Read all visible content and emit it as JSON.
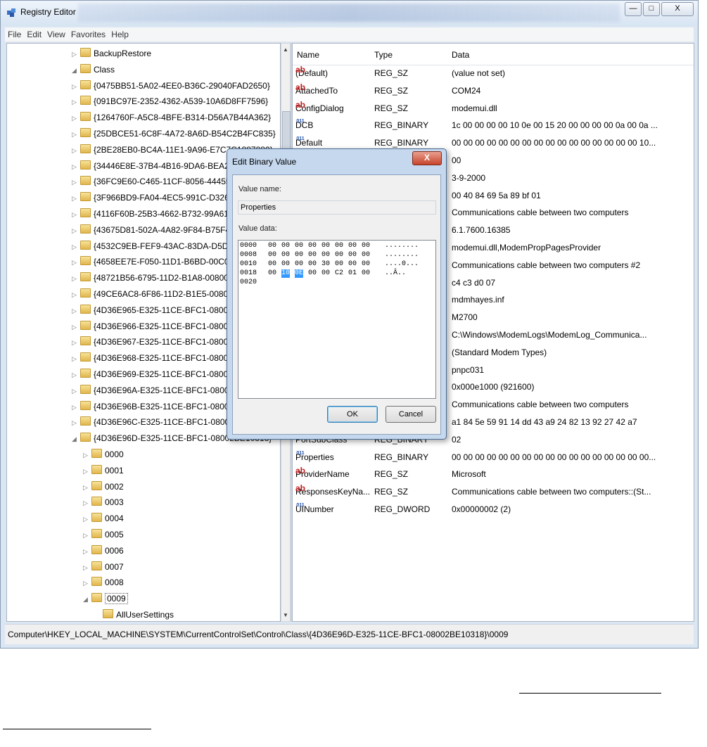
{
  "window": {
    "title": "Registry Editor",
    "controls": {
      "minimize": "—",
      "maximize": "□",
      "close": "X"
    }
  },
  "menu": [
    "File",
    "Edit",
    "View",
    "Favorites",
    "Help"
  ],
  "tree": [
    {
      "label": "BackupRestore",
      "level": 0,
      "expander": "▷"
    },
    {
      "label": "Class",
      "level": 0,
      "expander": "◢"
    },
    {
      "label": "{0475BB51-5A02-4EE0-B36C-29040FAD2650}",
      "level": 1,
      "expander": "▷"
    },
    {
      "label": "{091BC97E-2352-4362-A539-10A6D8FF7596}",
      "level": 1,
      "expander": "▷"
    },
    {
      "label": "{1264760F-A5C8-4BFE-B314-D56A7B44A362}",
      "level": 1,
      "expander": "▷"
    },
    {
      "label": "{25DBCE51-6C8F-4A72-8A6D-B54C2B4FC835}",
      "level": 1,
      "expander": "▷"
    },
    {
      "label": "{2BE28EB0-BC4A-11E1-9A96-E7C7C1887880}",
      "level": 1,
      "expander": "▷"
    },
    {
      "label": "{34446E8E-37B4-4B16-9DA6-BEA2",
      "level": 1,
      "expander": "▷"
    },
    {
      "label": "{36FC9E60-C465-11CF-8056-44455",
      "level": 1,
      "expander": "▷"
    },
    {
      "label": "{3F966BD9-FA04-4EC5-991C-D326",
      "level": 1,
      "expander": "▷"
    },
    {
      "label": "{4116F60B-25B3-4662-B732-99A61",
      "level": 1,
      "expander": "▷"
    },
    {
      "label": "{43675D81-502A-4A82-9F84-B75F4",
      "level": 1,
      "expander": "▷"
    },
    {
      "label": "{4532C9EB-FEF9-43AC-83DA-D5DE",
      "level": 1,
      "expander": "▷"
    },
    {
      "label": "{4658EE7E-F050-11D1-B6BD-00C0",
      "level": 1,
      "expander": "▷"
    },
    {
      "label": "{48721B56-6795-11D2-B1A8-00800",
      "level": 1,
      "expander": "▷"
    },
    {
      "label": "{49CE6AC8-6F86-11D2-B1E5-00800",
      "level": 1,
      "expander": "▷"
    },
    {
      "label": "{4D36E965-E325-11CE-BFC1-08002",
      "level": 1,
      "expander": "▷"
    },
    {
      "label": "{4D36E966-E325-11CE-BFC1-08002",
      "level": 1,
      "expander": "▷"
    },
    {
      "label": "{4D36E967-E325-11CE-BFC1-08002",
      "level": 1,
      "expander": "▷"
    },
    {
      "label": "{4D36E968-E325-11CE-BFC1-08002",
      "level": 1,
      "expander": "▷"
    },
    {
      "label": "{4D36E969-E325-11CE-BFC1-08002",
      "level": 1,
      "expander": "▷"
    },
    {
      "label": "{4D36E96A-E325-11CE-BFC1-08002",
      "level": 1,
      "expander": "▷"
    },
    {
      "label": "{4D36E96B-E325-11CE-BFC1-08002",
      "level": 1,
      "expander": "▷"
    },
    {
      "label": "{4D36E96C-E325-11CE-BFC1-08002",
      "level": 1,
      "expander": "▷"
    },
    {
      "label": "{4D36E96D-E325-11CE-BFC1-08002BE10318}",
      "level": 1,
      "expander": "◢"
    },
    {
      "label": "0000",
      "level": 2,
      "expander": "▷"
    },
    {
      "label": "0001",
      "level": 2,
      "expander": "▷"
    },
    {
      "label": "0002",
      "level": 2,
      "expander": "▷"
    },
    {
      "label": "0003",
      "level": 2,
      "expander": "▷"
    },
    {
      "label": "0004",
      "level": 2,
      "expander": "▷"
    },
    {
      "label": "0005",
      "level": 2,
      "expander": "▷"
    },
    {
      "label": "0006",
      "level": 2,
      "expander": "▷"
    },
    {
      "label": "0007",
      "level": 2,
      "expander": "▷"
    },
    {
      "label": "0008",
      "level": 2,
      "expander": "▷"
    },
    {
      "label": "0009",
      "level": 2,
      "expander": "◢"
    },
    {
      "label": "AllUserSettings",
      "level": 3,
      "expander": ""
    }
  ],
  "list": {
    "headers": {
      "name": "Name",
      "type": "Type",
      "data": "Data"
    },
    "rows": [
      {
        "icon": "ab",
        "name": "(Default)",
        "type": "REG_SZ",
        "data": "(value not set)"
      },
      {
        "icon": "ab",
        "name": "AttachedTo",
        "type": "REG_SZ",
        "data": "COM24"
      },
      {
        "icon": "ab",
        "name": "ConfigDialog",
        "type": "REG_SZ",
        "data": "modemui.dll"
      },
      {
        "icon": "bin",
        "name": "DCB",
        "type": "REG_BINARY",
        "data": "1c 00 00 00 00 10 0e 00 15 20 00 00 00 00 0a 00 0a ..."
      },
      {
        "icon": "bin",
        "name": "Default",
        "type": "REG_BINARY",
        "data": "00 00 00 00 00 00 00 00 00 00 00 00 00 00 00 00 10..."
      },
      {
        "icon": "bin",
        "name": "",
        "type": "",
        "data": "00"
      },
      {
        "icon": "",
        "name": "",
        "type": "",
        "data": "3-9-2000"
      },
      {
        "icon": "",
        "name": "",
        "type": "",
        "data": "00 40 84 69 5a 89 bf 01"
      },
      {
        "icon": "",
        "name": "",
        "type": "",
        "data": "Communications cable between two computers"
      },
      {
        "icon": "",
        "name": "",
        "type": "",
        "data": "6.1.7600.16385"
      },
      {
        "icon": "",
        "name": "",
        "type": "",
        "data": "modemui.dll,ModemPropPagesProvider"
      },
      {
        "icon": "",
        "name": "",
        "type": "",
        "data": "Communications cable between two computers #2"
      },
      {
        "icon": "",
        "name": "",
        "type": "",
        "data": "c4 c3 d0 07"
      },
      {
        "icon": "",
        "name": "",
        "type": "",
        "data": "mdmhayes.inf"
      },
      {
        "icon": "",
        "name": "",
        "type": "",
        "data": "M2700"
      },
      {
        "icon": "",
        "name": "",
        "type": "",
        "data": "C:\\Windows\\ModemLogs\\ModemLog_Communica..."
      },
      {
        "icon": "",
        "name": "",
        "type": "",
        "data": "(Standard Modem Types)"
      },
      {
        "icon": "",
        "name": "",
        "type": "",
        "data": "pnpc031"
      },
      {
        "icon": "",
        "name": "",
        "type": "",
        "data": "0x000e1000 (921600)"
      },
      {
        "icon": "",
        "name": "",
        "type": "",
        "data": "Communications cable between two computers"
      },
      {
        "icon": "",
        "name": "",
        "type": "",
        "data": "a1 84 5e 59 91 14 dd 43 a9 24 82 13 92 27 42 a7"
      },
      {
        "icon": "bin",
        "name": "PortSubClass",
        "type": "REG_BINARY",
        "data": "02"
      },
      {
        "icon": "bin",
        "name": "Properties",
        "type": "REG_BINARY",
        "data": "00 00 00 00 00 00 00 00 00 00 00 00 00 00 00 00 00..."
      },
      {
        "icon": "ab",
        "name": "ProviderName",
        "type": "REG_SZ",
        "data": "Microsoft"
      },
      {
        "icon": "ab",
        "name": "ResponsesKeyNa...",
        "type": "REG_SZ",
        "data": "Communications cable between two computers::(St..."
      },
      {
        "icon": "bin",
        "name": "UINumber",
        "type": "REG_DWORD",
        "data": "0x00000002 (2)"
      }
    ]
  },
  "statusbar": "Computer\\HKEY_LOCAL_MACHINE\\SYSTEM\\CurrentControlSet\\Control\\Class\\{4D36E96D-E325-11CE-BFC1-08002BE10318}\\0009",
  "dialog": {
    "title": "Edit Binary Value",
    "close": "X",
    "value_name_label": "Value name:",
    "value_name": "Properties",
    "value_data_label": "Value data:",
    "hex": [
      {
        "offset": "0000",
        "bytes": [
          "00",
          "00",
          "00",
          "00",
          "00",
          "00",
          "00",
          "00"
        ],
        "ascii": "........"
      },
      {
        "offset": "0008",
        "bytes": [
          "00",
          "00",
          "00",
          "00",
          "00",
          "00",
          "00",
          "00"
        ],
        "ascii": "........"
      },
      {
        "offset": "0010",
        "bytes": [
          "00",
          "00",
          "00",
          "00",
          "30",
          "00",
          "00",
          "00"
        ],
        "ascii": "....0..."
      },
      {
        "offset": "0018",
        "bytes": [
          "00",
          "10",
          "0E",
          "00",
          "00",
          "C2",
          "01",
          "00"
        ],
        "ascii": "..Â.."
      },
      {
        "offset": "0020",
        "bytes": [],
        "ascii": ""
      }
    ],
    "ok": "OK",
    "cancel": "Cancel"
  }
}
